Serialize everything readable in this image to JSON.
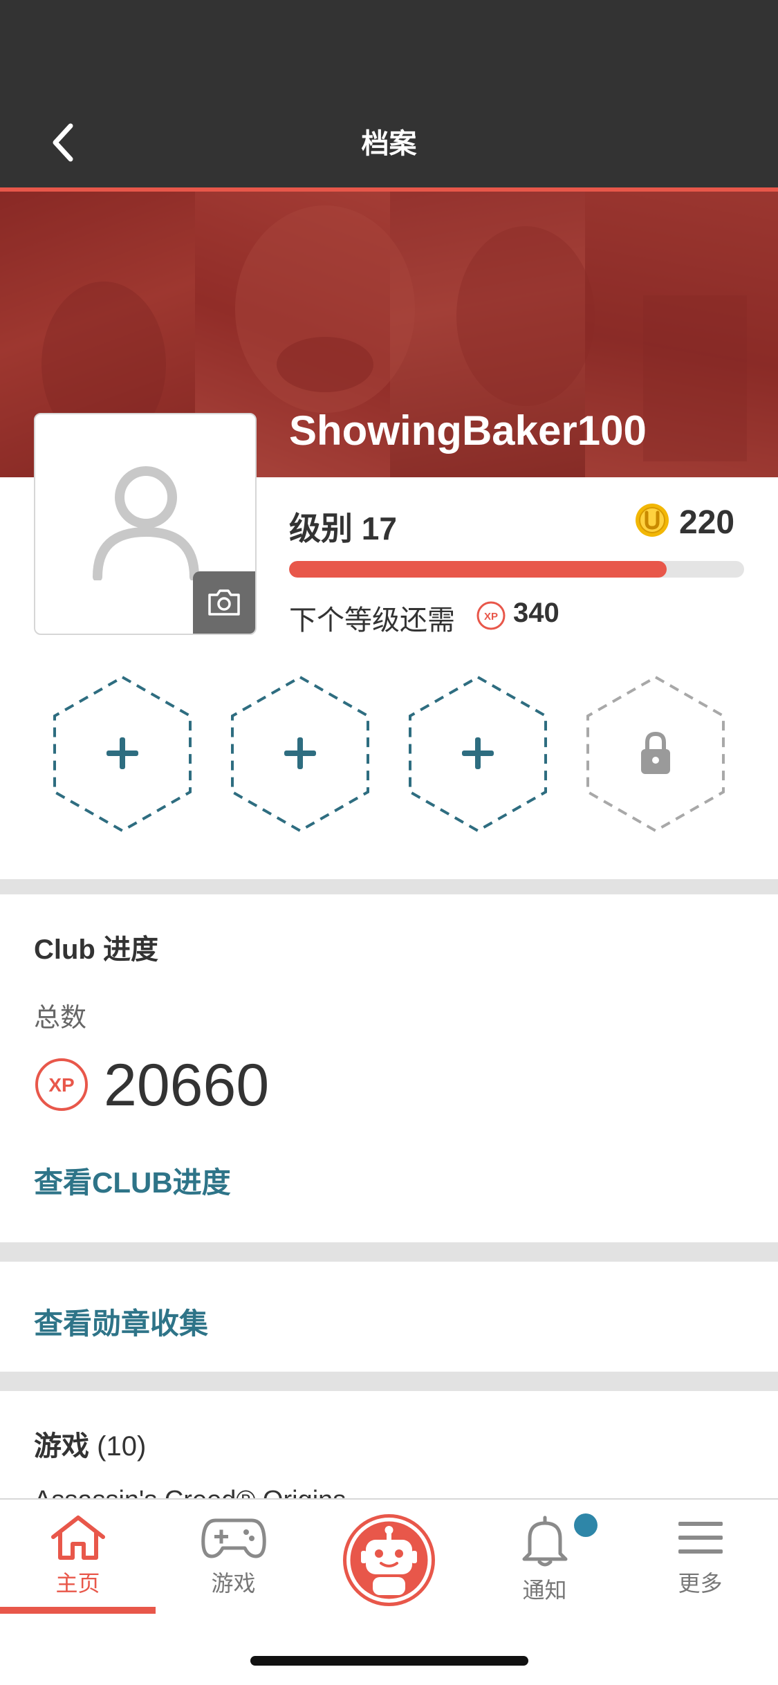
{
  "header": {
    "title": "档案"
  },
  "profile": {
    "username": "ShowingBaker100",
    "level_label": "级别 17",
    "coins": "220",
    "level_progress": 0.83,
    "next_level_label": "下个等级还需",
    "xp_needed": "340"
  },
  "badges": {
    "slots": [
      "add",
      "add",
      "add",
      "locked"
    ]
  },
  "club": {
    "title": "Club 进度",
    "total_label": "总数",
    "total_xp": "20660",
    "view_link": "查看CLUB进度"
  },
  "badges_link": "查看勋章收集",
  "games": {
    "title": "游戏",
    "count": "(10)",
    "first_game": "Assassin's Creed® Origins"
  },
  "tabbar": {
    "home": "主页",
    "games": "游戏",
    "notifications": "通知",
    "more": "更多"
  },
  "colors": {
    "accent": "#e8574a",
    "link": "#2e7488",
    "header_bg": "#333333",
    "banner_tint": "#8e3430",
    "notify_dot": "#2e86a8"
  },
  "icons": {
    "back": "chevron-left-icon",
    "camera": "camera-icon",
    "coin": "coin-icon",
    "xp": "xp-icon",
    "add_badge": "plus-icon",
    "locked_badge": "lock-icon",
    "home": "home-icon",
    "games": "gamepad-icon",
    "assistant": "robot-icon",
    "notifications": "bell-icon",
    "more": "menu-icon"
  }
}
